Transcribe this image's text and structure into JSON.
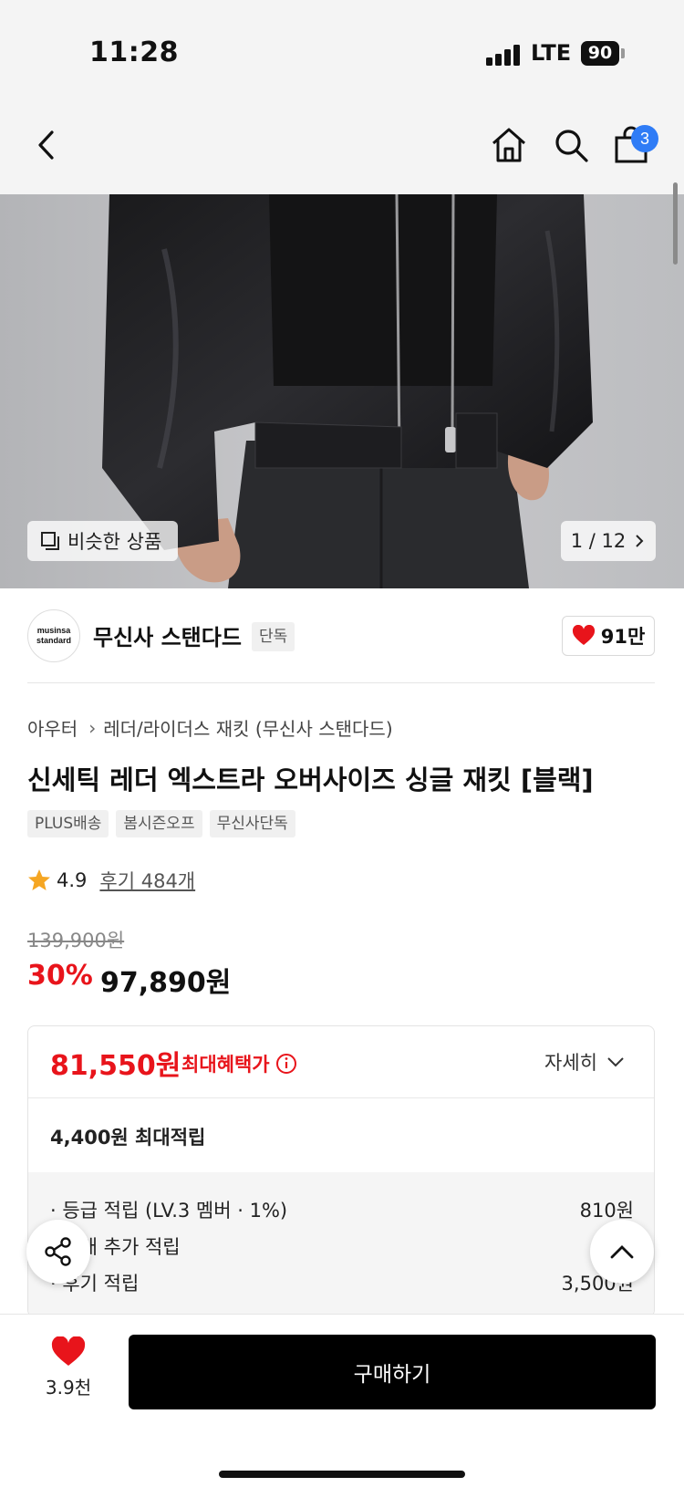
{
  "status_bar": {
    "time": "11:28",
    "network": "LTE",
    "battery": "90"
  },
  "nav": {
    "cart_count": "3"
  },
  "hero": {
    "similar_label": "비슷한 상품",
    "counter": "1 / 12"
  },
  "brand": {
    "logo_line1": "musinsa",
    "logo_line2": "standard",
    "name": "무신사 스탠다드",
    "tag": "단독",
    "likes": "91만"
  },
  "breadcrumb": {
    "category": "아우터",
    "subcategory": "레더/라이더스 재킷 (무신사 스탠다드)"
  },
  "product": {
    "title": "신세틱 레더 엑스트라 오버사이즈 싱글 재킷 [블랙]",
    "tags": [
      "PLUS배송",
      "봄시즌오프",
      "무신사단독"
    ],
    "rating": "4.9",
    "reviews": "후기 484개",
    "original_price": "139,900원",
    "discount": "30%",
    "sale_price": "97,890원"
  },
  "benefit": {
    "max_price": "81,550원",
    "max_label": "최대혜택가",
    "detail": "자세히",
    "points_total": "4,400원 최대적립",
    "rows": [
      {
        "label": "· 등급 적립 (LV.3 멤버 · 1%)",
        "amount": "810원"
      },
      {
        "label": "· 구매 추가 적립",
        "amount": ""
      },
      {
        "label": "· 후기 적립",
        "amount": "3,500원"
      }
    ]
  },
  "bottom": {
    "wish_count": "3.9천",
    "buy_label": "구매하기"
  },
  "colors": {
    "accent_red": "#e8141b",
    "badge_blue": "#2f7cf6",
    "buy_black": "#000000"
  }
}
